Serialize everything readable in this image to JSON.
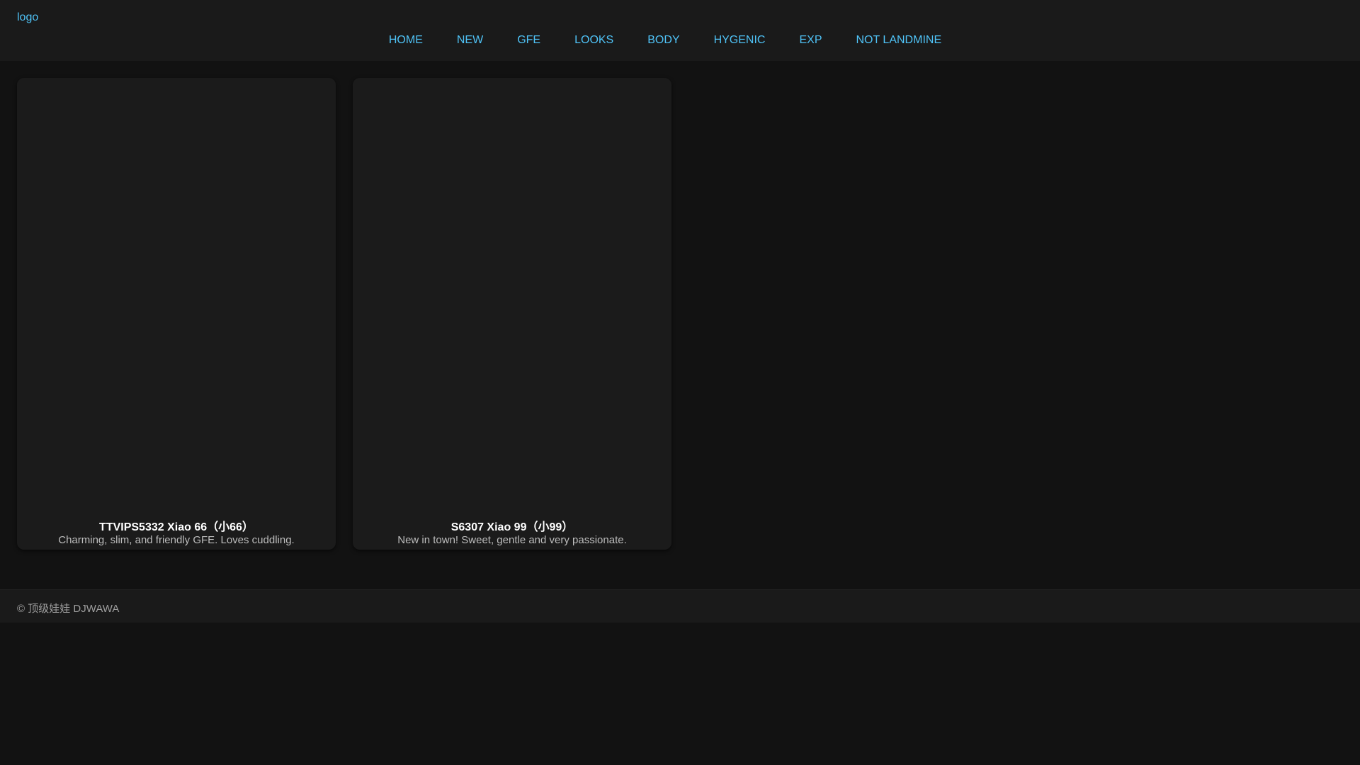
{
  "header": {
    "logo_alt": "logo",
    "nav": [
      {
        "label": "HOME"
      },
      {
        "label": "NEW"
      },
      {
        "label": "GFE"
      },
      {
        "label": "LOOKS"
      },
      {
        "label": "BODY"
      },
      {
        "label": "HYGENIC"
      },
      {
        "label": "EXP"
      },
      {
        "label": "NOT LANDMINE"
      }
    ]
  },
  "cards": [
    {
      "title": "TTVIPS5332 Xiao 66（小66）",
      "description": "Charming, slim, and friendly GFE. Loves cuddling."
    },
    {
      "title": "S6307 Xiao 99（小99）",
      "description": "New in town! Sweet, gentle and very passionate."
    }
  ],
  "footer": {
    "text": "© 顶级娃娃 DJWAWA"
  },
  "colors": {
    "accent": "#4fc3f7",
    "background": "#121212",
    "header_bg": "#1a1a1a",
    "card_bg": "#1b1b1b"
  }
}
